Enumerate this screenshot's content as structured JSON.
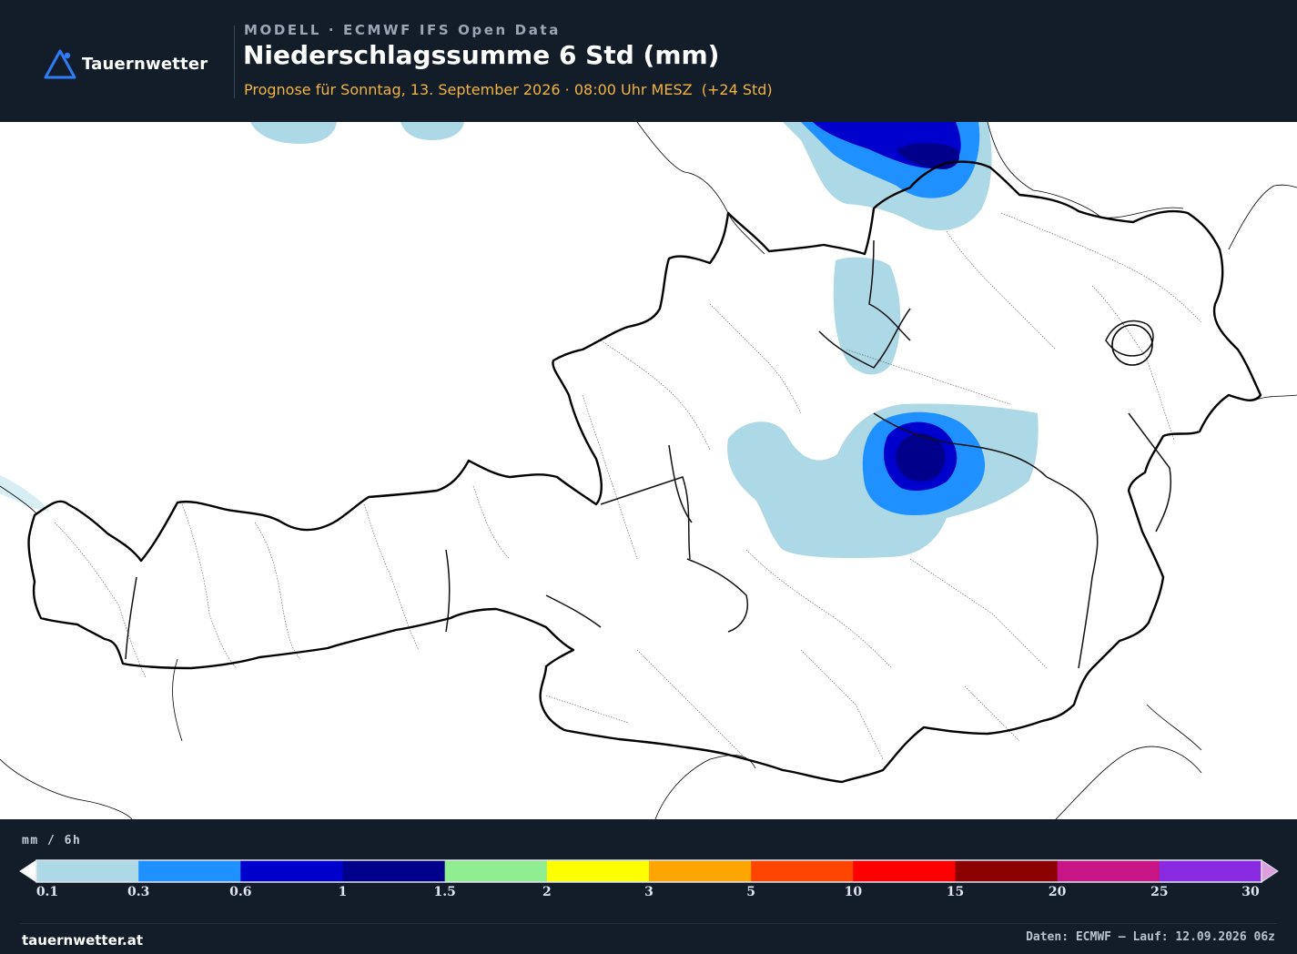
{
  "brand": {
    "name": "Tauernwetter",
    "logo_icon": "mountain-triangle-icon",
    "logo_color": "#2f7df6"
  },
  "header": {
    "model_line": "MODELL · ECMWF IFS Open Data",
    "title": "Niederschlagssumme 6 Std (mm)",
    "subtitle": "Prognose für Sonntag, 13. September 2026 · 08:00 Uhr MESZ  (+24 Std)",
    "title_color": "#ffffff",
    "subtitle_color": "#f2b440"
  },
  "map": {
    "region": "Austria",
    "background": "#ffffff",
    "border_color": "#000000",
    "precip_areas": [
      {
        "name": "Mühlviertel / Bohemian border",
        "max_mm": 1.5
      },
      {
        "name": "Innviertel",
        "max_mm": 0.3
      },
      {
        "name": "Traunviertel / Styrian border",
        "max_mm": 1.5
      }
    ]
  },
  "legend": {
    "unit": "mm / 6h",
    "bins": [
      {
        "from": 0.1,
        "to": 0.3,
        "color": "#add8e6"
      },
      {
        "from": 0.3,
        "to": 0.6,
        "color": "#1e90ff"
      },
      {
        "from": 0.6,
        "to": 1,
        "color": "#0000cd"
      },
      {
        "from": 1,
        "to": 1.5,
        "color": "#00008b"
      },
      {
        "from": 1.5,
        "to": 2,
        "color": "#90ee90"
      },
      {
        "from": 2,
        "to": 3,
        "color": "#ffff00"
      },
      {
        "from": 3,
        "to": 5,
        "color": "#ffa500"
      },
      {
        "from": 5,
        "to": 10,
        "color": "#ff4500"
      },
      {
        "from": 10,
        "to": 15,
        "color": "#ff0000"
      },
      {
        "from": 15,
        "to": 20,
        "color": "#8b0000"
      },
      {
        "from": 20,
        "to": 25,
        "color": "#c71585"
      },
      {
        "from": 25,
        "to": 30,
        "color": "#8a2be2"
      }
    ],
    "under_color": "#ffffff",
    "over_color": "#dda0dd",
    "tick_labels": [
      "0.1",
      "0.3",
      "0.6",
      "1",
      "1.5",
      "2",
      "3",
      "5",
      "10",
      "15",
      "20",
      "25",
      "30"
    ]
  },
  "footer": {
    "site": "tauernwetter.at",
    "source": "Daten: ECMWF – Lauf: 12.09.2026 06z"
  }
}
